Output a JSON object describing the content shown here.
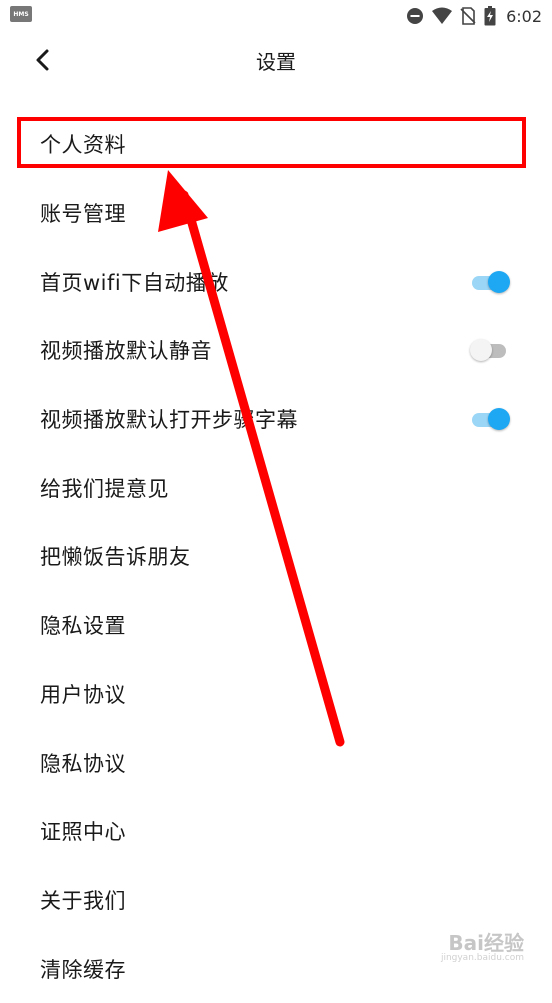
{
  "status_bar": {
    "app_badge": "HMS",
    "time": "6:02"
  },
  "header": {
    "title": "设置"
  },
  "menu": [
    {
      "label": "个人资料"
    },
    {
      "label": "账号管理"
    },
    {
      "label": "首页wifi下自动播放",
      "toggle": true
    },
    {
      "label": "视频播放默认静音",
      "toggle": false
    },
    {
      "label": "视频播放默认打开步骤字幕",
      "toggle": true
    },
    {
      "label": "给我们提意见"
    },
    {
      "label": "把懒饭告诉朋友"
    },
    {
      "label": "隐私设置"
    },
    {
      "label": "用户协议"
    },
    {
      "label": "隐私协议"
    },
    {
      "label": "证照中心"
    },
    {
      "label": "关于我们"
    },
    {
      "label": "清除缓存"
    }
  ],
  "watermark": {
    "text": "Bai经验",
    "sub": "jingyan.baidu.com"
  },
  "colors": {
    "toggle_on": "#1ea7f2",
    "toggle_off": "#bdbdbd",
    "annotation": "#ff0000"
  }
}
